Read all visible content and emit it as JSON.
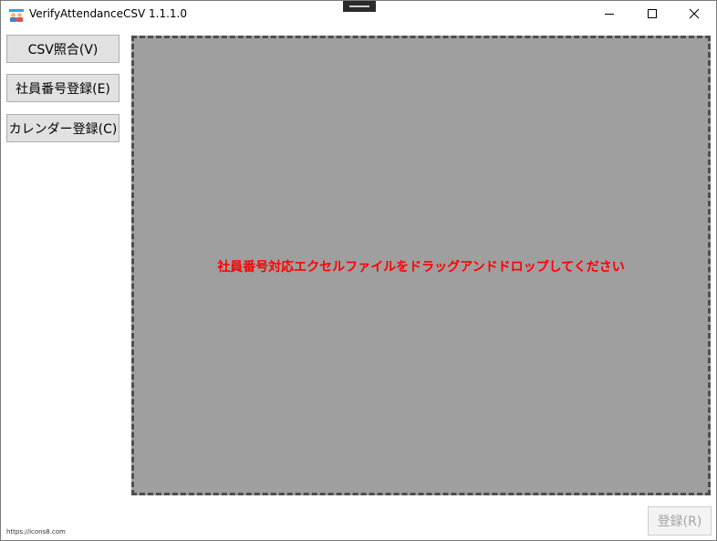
{
  "window": {
    "title": "VerifyAttendanceCSV 1.1.1.0"
  },
  "sidebar": {
    "csv_button": "CSV照合(V)",
    "employee_button": "社員番号登録(E)",
    "calendar_button": "カレンダー登録(C)"
  },
  "drop_area": {
    "message": "社員番号対応エクセルファイルをドラッグアンドドロップしてください",
    "message_color": "#ff0000"
  },
  "footer": {
    "credit": "https://icons8.com",
    "register_button": "登録(R)"
  }
}
